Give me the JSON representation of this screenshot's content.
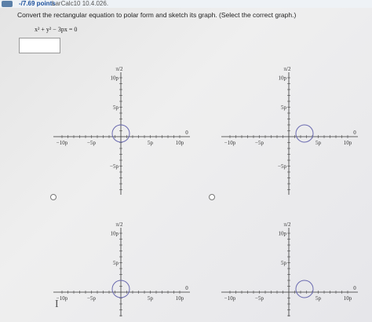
{
  "header": {
    "points": "-/7.69 points",
    "reference": "LarCalc10 10.4.026."
  },
  "question": {
    "prompt": "Convert the rectangular equation to polar form and sketch its graph. (Select the correct graph.)",
    "equation": "x² + y² − 3px = 0",
    "answer_value": ""
  },
  "graph_labels": {
    "top": "π/2",
    "right": "0",
    "y_ticks": [
      "10p",
      "5p",
      "−5p",
      "−10p"
    ],
    "x_ticks": [
      "−10p",
      "−5p",
      "5p",
      "10p"
    ]
  },
  "options": [
    {
      "id": "a",
      "circle_side": "left"
    },
    {
      "id": "b",
      "circle_side": "right"
    },
    {
      "id": "c",
      "circle_side": "left"
    },
    {
      "id": "d",
      "circle_side": "right"
    }
  ],
  "colors": {
    "axis": "#333333",
    "circle": "#6a6ab0",
    "question_text": "#222222",
    "points": "#1b4f9c"
  },
  "icons": {
    "cursor": "text-cursor-icon"
  }
}
